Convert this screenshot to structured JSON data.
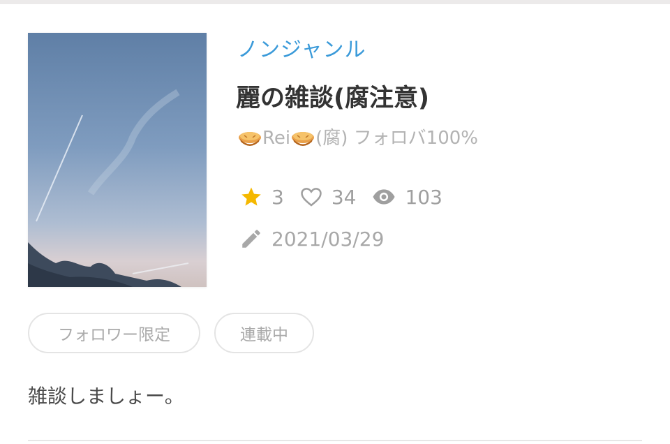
{
  "work": {
    "genre": "ノンジャンル",
    "title": "麗の雑談(腐注意)",
    "author": {
      "name": "Rei",
      "suffix": "(腐) フォロバ100%",
      "decoration_icon": "pie-emoji"
    },
    "stats": {
      "stars": "3",
      "likes": "34",
      "views": "103"
    },
    "updated_date": "2021/03/29",
    "tags": [
      "フォロワー限定",
      "連載中"
    ],
    "description": "雑談しましょー。"
  },
  "colors": {
    "genre": "#3a9ad9",
    "title": "#333333",
    "star": "#f5b800",
    "muted": "#a8a8a8"
  }
}
